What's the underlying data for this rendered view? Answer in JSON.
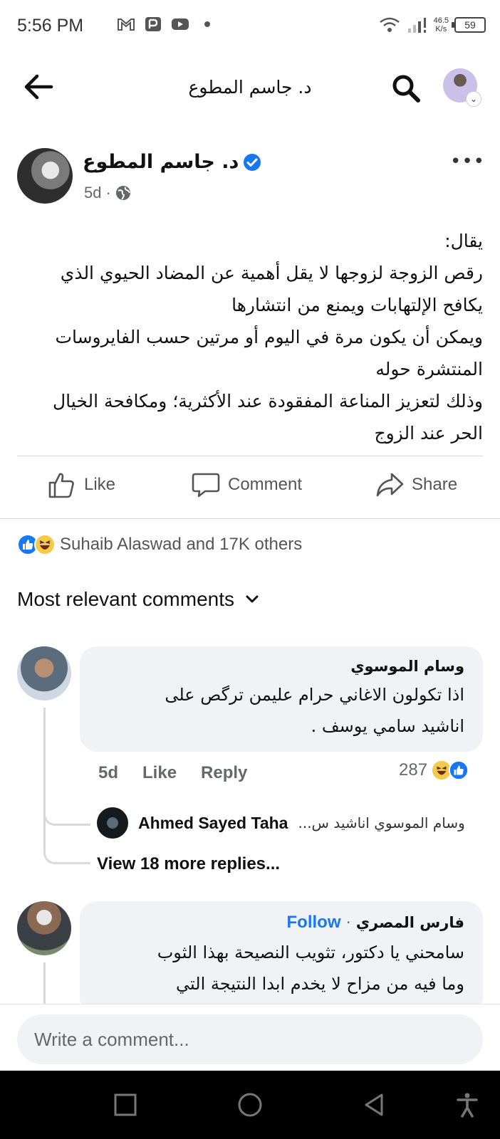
{
  "status_bar": {
    "time": "5:56 PM",
    "speed": "46.5",
    "speed_unit": "K/s",
    "battery": "59",
    "icons": [
      "gmail-icon",
      "pinterest-icon",
      "youtube-icon",
      "dot-icon",
      "wifi-icon",
      "signal-icon"
    ]
  },
  "header": {
    "title": "د. جاسم المطوع",
    "back_icon": "arrow-left-icon",
    "search_icon": "search-icon"
  },
  "post": {
    "author": "د. جاسم المطوع",
    "verified": true,
    "time": "5d",
    "audience_icon": "globe-icon",
    "more_icon": "•••",
    "body": [
      "يقال:",
      "رقص الزوجة لزوجها لا يقل أهمية عن المضاد الحيوي الذي",
      "يكافح الإلتهابات ويمنع من انتشارها",
      "ويمكن أن يكون مرة في اليوم أو مرتين حسب الفايروسات",
      "المنتشرة حوله",
      "وذلك لتعزيز المناعة المفقودة عند الأكثرية؛ ومكافحة الخيال",
      "الحر عند الزوج"
    ],
    "actions": {
      "like": "Like",
      "comment": "Comment",
      "share": "Share"
    },
    "reactions_text": "Suhaib Alaswad and 17K others"
  },
  "comments_section": {
    "sort_label": "Most relevant comments",
    "comments": [
      {
        "author": "وسام الموسوي",
        "text_lines": [
          "اذا تكولون الاغاني حرام عليمن ترگص على",
          "اناشيد سامي يوسف ."
        ],
        "time": "5d",
        "like": "Like",
        "reply": "Reply",
        "reaction_count": "287",
        "reply_preview": {
          "author": "Ahmed Sayed Taha",
          "text": "وسام الموسوي اناشيد س..."
        },
        "more_replies": "View 18 more replies..."
      },
      {
        "author": "فارس المصري",
        "follow": "Follow",
        "separator": "·",
        "text_lines": [
          "سامحني يا دكتور، تثويب  النصيحة بهذا الثوب",
          "وما فيه من مزاح لا يخدم ابدا النتيجة التي"
        ]
      }
    ]
  },
  "composer": {
    "placeholder": "Write a comment..."
  },
  "colors": {
    "facebook_blue": "#1877f2",
    "bubble_bg": "#f0f2f5",
    "haha_yellow": "#f7c94a"
  }
}
